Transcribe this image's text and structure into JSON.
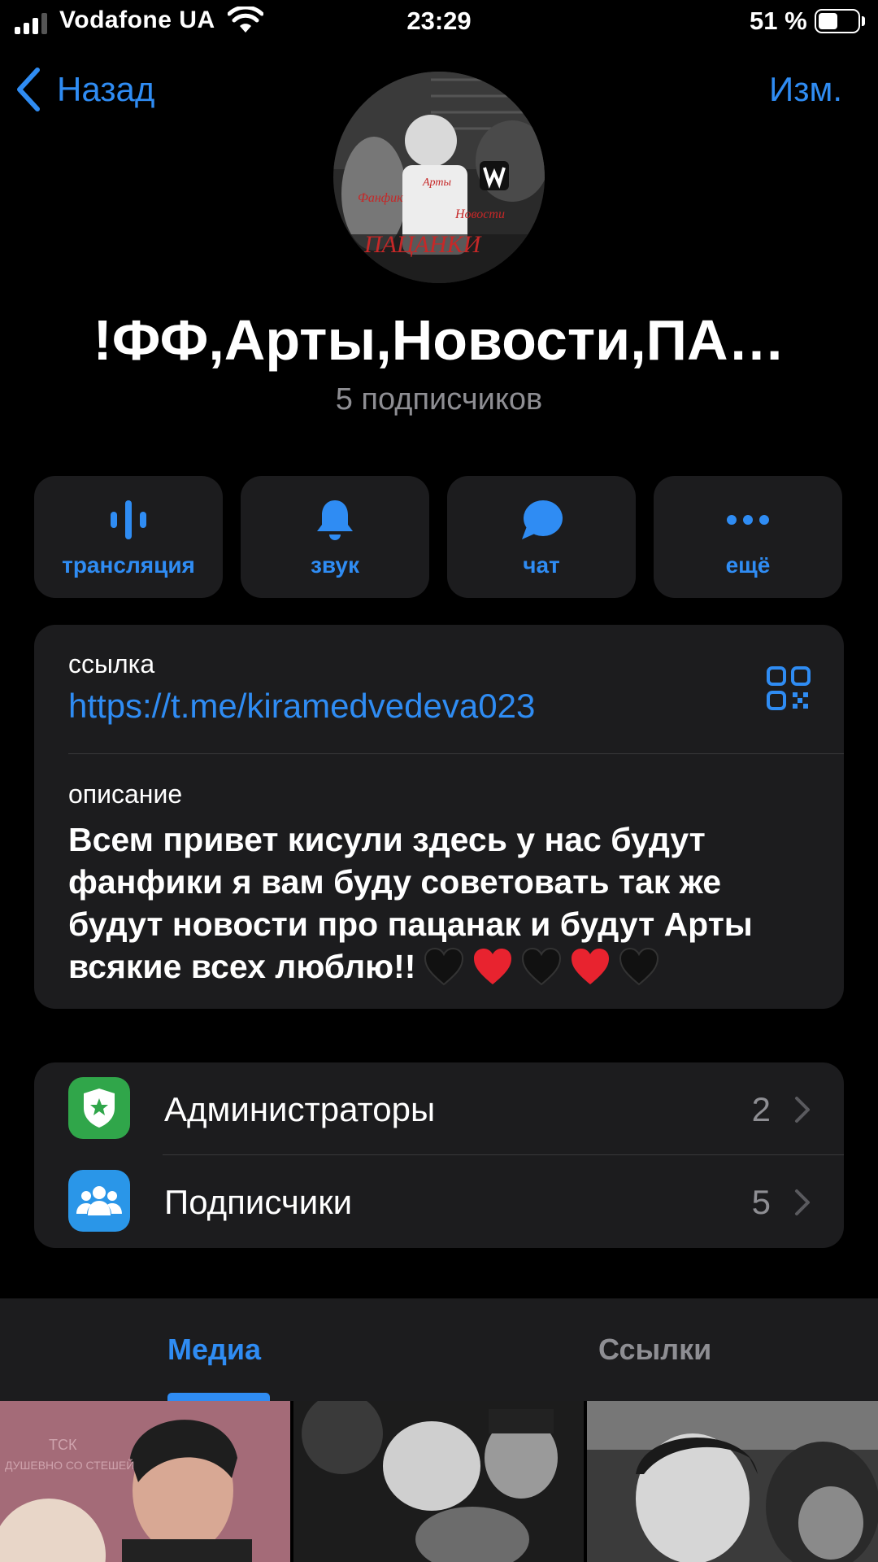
{
  "status_bar": {
    "carrier": "Vodafone UA",
    "time": "23:29",
    "battery_percent_label": "51 %",
    "battery_level": 0.51,
    "signal_bars": 3,
    "signal_icon": "cellular-signal-icon",
    "wifi_icon": "wifi-icon",
    "battery_icon": "battery-icon"
  },
  "nav": {
    "back_label": "Назад",
    "edit_label": "Изм."
  },
  "channel": {
    "title": "!ФФ,Арты,Новости,ПА…",
    "subscribers_text": "5 подписчиков",
    "avatar_texts": {
      "fanfic": "Фанфик",
      "arts": "Арты",
      "news": "Новости",
      "main": "ПАЦАНКИ"
    }
  },
  "actions": [
    {
      "label": "трансляция",
      "icon": "live-stream-icon"
    },
    {
      "label": "звук",
      "icon": "bell-icon"
    },
    {
      "label": "чат",
      "icon": "chat-bubble-icon"
    },
    {
      "label": "ещё",
      "icon": "more-dots-icon"
    }
  ],
  "info": {
    "link_caption": "ссылка",
    "link_url": "https://t.me/kiramedvedeva023",
    "description_caption": "описание",
    "description_text": "Всем привет кисули здесь у нас будут фанфики я вам буду советовать так же будут новости про пацанак и будут Арты всякие всех люблю!!",
    "description_emojis": [
      "black-heart",
      "red-heart",
      "black-heart",
      "red-heart",
      "black-heart"
    ],
    "qr_icon": "qr-code-icon"
  },
  "list": [
    {
      "label": "Администраторы",
      "count": "2",
      "icon": "admin-shield-icon",
      "color": "#30a64a"
    },
    {
      "label": "Подписчики",
      "count": "5",
      "icon": "subscribers-icon",
      "color": "#2a96e8"
    }
  ],
  "tabs": {
    "media": "Медиа",
    "links": "Ссылки",
    "active": "media"
  },
  "media_overlay_text": [
    "ТСК",
    "ДУШЕВНО СО СТЕШЕЙ"
  ],
  "colors": {
    "accent": "#2f8cf3",
    "card": "#1c1c1e",
    "secondary_text": "#8e8e93"
  }
}
